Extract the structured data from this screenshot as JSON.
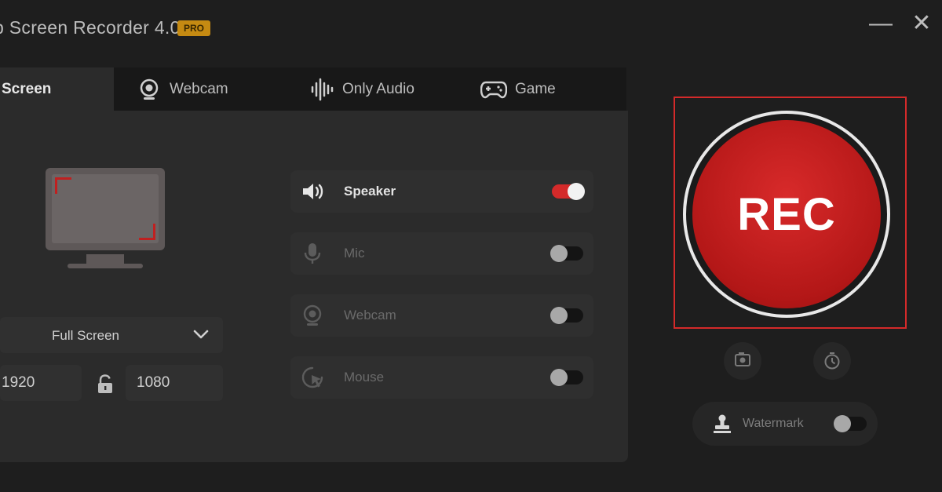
{
  "app": {
    "title": "p Screen Recorder 4.0",
    "badge": "PRO",
    "minimize_glyph": "—",
    "close_glyph": "✕"
  },
  "tabs": [
    {
      "label": "Screen",
      "icon": "monitor-icon",
      "active": true
    },
    {
      "label": "Webcam",
      "icon": "webcam-icon",
      "active": false
    },
    {
      "label": "Only Audio",
      "icon": "audio-wave-icon",
      "active": false
    },
    {
      "label": "Game",
      "icon": "gamepad-icon",
      "active": false
    }
  ],
  "capture": {
    "mode": "Full Screen",
    "width": "1920",
    "height": "1080"
  },
  "toggles": [
    {
      "label": "Speaker",
      "icon": "speaker-icon",
      "on": true
    },
    {
      "label": "Mic",
      "icon": "microphone-icon",
      "on": false
    },
    {
      "label": "Webcam",
      "icon": "webcam-icon",
      "on": false
    },
    {
      "label": "Mouse",
      "icon": "mouse-cursor-icon",
      "on": false
    }
  ],
  "record": {
    "label": "REC",
    "secondary_buttons": [
      {
        "icon": "screenshot-icon"
      },
      {
        "icon": "timer-icon"
      }
    ]
  },
  "watermark": {
    "label": "Watermark",
    "icon": "stamp-icon",
    "on": false
  },
  "colors": {
    "accent": "#d42a2a",
    "badge": "#c58a12",
    "panel": "#2b2b2b",
    "background": "#1e1e1e"
  }
}
